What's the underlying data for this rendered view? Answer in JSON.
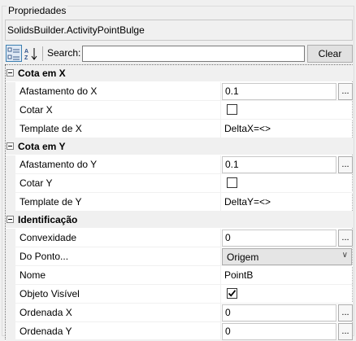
{
  "panel": {
    "title": "Propriedades",
    "object_name": "SolidsBuilder.ActivityPointBulge"
  },
  "toolbar": {
    "search_label": "Search:",
    "search_value": "",
    "clear_label": "Clear"
  },
  "categories": [
    {
      "label": "Cota em X",
      "props": [
        {
          "name": "Afastamento do X",
          "value": "0.1",
          "editor": "text-ellipsis"
        },
        {
          "name": "Cotar X",
          "checked": false,
          "editor": "checkbox"
        },
        {
          "name": "Template de X",
          "value": "DeltaX=<>",
          "editor": "plain"
        }
      ]
    },
    {
      "label": "Cota em Y",
      "props": [
        {
          "name": "Afastamento do Y",
          "value": "0.1",
          "editor": "text-ellipsis"
        },
        {
          "name": "Cotar Y",
          "checked": false,
          "editor": "checkbox"
        },
        {
          "name": "Template de Y",
          "value": "DeltaY=<>",
          "editor": "plain"
        }
      ]
    },
    {
      "label": "Identificação",
      "props": [
        {
          "name": "Convexidade",
          "value": "0",
          "editor": "text-ellipsis"
        },
        {
          "name": "Do Ponto...",
          "value": "Origem",
          "editor": "dropdown"
        },
        {
          "name": "Nome",
          "value": "PointB",
          "editor": "plain"
        },
        {
          "name": "Objeto Visível",
          "checked": true,
          "editor": "checkbox"
        },
        {
          "name": "Ordenada X",
          "value": "0",
          "editor": "text-ellipsis"
        },
        {
          "name": "Ordenada Y",
          "value": "0",
          "editor": "text-ellipsis"
        }
      ]
    }
  ],
  "icons": {
    "categorized": "categorized-view-icon",
    "alphabetical": "sort-az-icon",
    "ellipsis": "...",
    "dropdown": "chevron-down-icon"
  }
}
